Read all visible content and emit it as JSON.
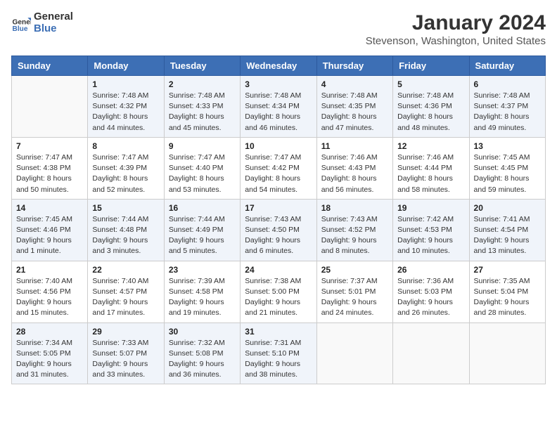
{
  "header": {
    "logo_line1": "General",
    "logo_line2": "Blue",
    "title": "January 2024",
    "subtitle": "Stevenson, Washington, United States"
  },
  "weekdays": [
    "Sunday",
    "Monday",
    "Tuesday",
    "Wednesday",
    "Thursday",
    "Friday",
    "Saturday"
  ],
  "weeks": [
    [
      {
        "num": "",
        "sunrise": "",
        "sunset": "",
        "daylight": ""
      },
      {
        "num": "1",
        "sunrise": "Sunrise: 7:48 AM",
        "sunset": "Sunset: 4:32 PM",
        "daylight": "Daylight: 8 hours and 44 minutes."
      },
      {
        "num": "2",
        "sunrise": "Sunrise: 7:48 AM",
        "sunset": "Sunset: 4:33 PM",
        "daylight": "Daylight: 8 hours and 45 minutes."
      },
      {
        "num": "3",
        "sunrise": "Sunrise: 7:48 AM",
        "sunset": "Sunset: 4:34 PM",
        "daylight": "Daylight: 8 hours and 46 minutes."
      },
      {
        "num": "4",
        "sunrise": "Sunrise: 7:48 AM",
        "sunset": "Sunset: 4:35 PM",
        "daylight": "Daylight: 8 hours and 47 minutes."
      },
      {
        "num": "5",
        "sunrise": "Sunrise: 7:48 AM",
        "sunset": "Sunset: 4:36 PM",
        "daylight": "Daylight: 8 hours and 48 minutes."
      },
      {
        "num": "6",
        "sunrise": "Sunrise: 7:48 AM",
        "sunset": "Sunset: 4:37 PM",
        "daylight": "Daylight: 8 hours and 49 minutes."
      }
    ],
    [
      {
        "num": "7",
        "sunrise": "Sunrise: 7:47 AM",
        "sunset": "Sunset: 4:38 PM",
        "daylight": "Daylight: 8 hours and 50 minutes."
      },
      {
        "num": "8",
        "sunrise": "Sunrise: 7:47 AM",
        "sunset": "Sunset: 4:39 PM",
        "daylight": "Daylight: 8 hours and 52 minutes."
      },
      {
        "num": "9",
        "sunrise": "Sunrise: 7:47 AM",
        "sunset": "Sunset: 4:40 PM",
        "daylight": "Daylight: 8 hours and 53 minutes."
      },
      {
        "num": "10",
        "sunrise": "Sunrise: 7:47 AM",
        "sunset": "Sunset: 4:42 PM",
        "daylight": "Daylight: 8 hours and 54 minutes."
      },
      {
        "num": "11",
        "sunrise": "Sunrise: 7:46 AM",
        "sunset": "Sunset: 4:43 PM",
        "daylight": "Daylight: 8 hours and 56 minutes."
      },
      {
        "num": "12",
        "sunrise": "Sunrise: 7:46 AM",
        "sunset": "Sunset: 4:44 PM",
        "daylight": "Daylight: 8 hours and 58 minutes."
      },
      {
        "num": "13",
        "sunrise": "Sunrise: 7:45 AM",
        "sunset": "Sunset: 4:45 PM",
        "daylight": "Daylight: 8 hours and 59 minutes."
      }
    ],
    [
      {
        "num": "14",
        "sunrise": "Sunrise: 7:45 AM",
        "sunset": "Sunset: 4:46 PM",
        "daylight": "Daylight: 9 hours and 1 minute."
      },
      {
        "num": "15",
        "sunrise": "Sunrise: 7:44 AM",
        "sunset": "Sunset: 4:48 PM",
        "daylight": "Daylight: 9 hours and 3 minutes."
      },
      {
        "num": "16",
        "sunrise": "Sunrise: 7:44 AM",
        "sunset": "Sunset: 4:49 PM",
        "daylight": "Daylight: 9 hours and 5 minutes."
      },
      {
        "num": "17",
        "sunrise": "Sunrise: 7:43 AM",
        "sunset": "Sunset: 4:50 PM",
        "daylight": "Daylight: 9 hours and 6 minutes."
      },
      {
        "num": "18",
        "sunrise": "Sunrise: 7:43 AM",
        "sunset": "Sunset: 4:52 PM",
        "daylight": "Daylight: 9 hours and 8 minutes."
      },
      {
        "num": "19",
        "sunrise": "Sunrise: 7:42 AM",
        "sunset": "Sunset: 4:53 PM",
        "daylight": "Daylight: 9 hours and 10 minutes."
      },
      {
        "num": "20",
        "sunrise": "Sunrise: 7:41 AM",
        "sunset": "Sunset: 4:54 PM",
        "daylight": "Daylight: 9 hours and 13 minutes."
      }
    ],
    [
      {
        "num": "21",
        "sunrise": "Sunrise: 7:40 AM",
        "sunset": "Sunset: 4:56 PM",
        "daylight": "Daylight: 9 hours and 15 minutes."
      },
      {
        "num": "22",
        "sunrise": "Sunrise: 7:40 AM",
        "sunset": "Sunset: 4:57 PM",
        "daylight": "Daylight: 9 hours and 17 minutes."
      },
      {
        "num": "23",
        "sunrise": "Sunrise: 7:39 AM",
        "sunset": "Sunset: 4:58 PM",
        "daylight": "Daylight: 9 hours and 19 minutes."
      },
      {
        "num": "24",
        "sunrise": "Sunrise: 7:38 AM",
        "sunset": "Sunset: 5:00 PM",
        "daylight": "Daylight: 9 hours and 21 minutes."
      },
      {
        "num": "25",
        "sunrise": "Sunrise: 7:37 AM",
        "sunset": "Sunset: 5:01 PM",
        "daylight": "Daylight: 9 hours and 24 minutes."
      },
      {
        "num": "26",
        "sunrise": "Sunrise: 7:36 AM",
        "sunset": "Sunset: 5:03 PM",
        "daylight": "Daylight: 9 hours and 26 minutes."
      },
      {
        "num": "27",
        "sunrise": "Sunrise: 7:35 AM",
        "sunset": "Sunset: 5:04 PM",
        "daylight": "Daylight: 9 hours and 28 minutes."
      }
    ],
    [
      {
        "num": "28",
        "sunrise": "Sunrise: 7:34 AM",
        "sunset": "Sunset: 5:05 PM",
        "daylight": "Daylight: 9 hours and 31 minutes."
      },
      {
        "num": "29",
        "sunrise": "Sunrise: 7:33 AM",
        "sunset": "Sunset: 5:07 PM",
        "daylight": "Daylight: 9 hours and 33 minutes."
      },
      {
        "num": "30",
        "sunrise": "Sunrise: 7:32 AM",
        "sunset": "Sunset: 5:08 PM",
        "daylight": "Daylight: 9 hours and 36 minutes."
      },
      {
        "num": "31",
        "sunrise": "Sunrise: 7:31 AM",
        "sunset": "Sunset: 5:10 PM",
        "daylight": "Daylight: 9 hours and 38 minutes."
      },
      {
        "num": "",
        "sunrise": "",
        "sunset": "",
        "daylight": ""
      },
      {
        "num": "",
        "sunrise": "",
        "sunset": "",
        "daylight": ""
      },
      {
        "num": "",
        "sunrise": "",
        "sunset": "",
        "daylight": ""
      }
    ]
  ]
}
